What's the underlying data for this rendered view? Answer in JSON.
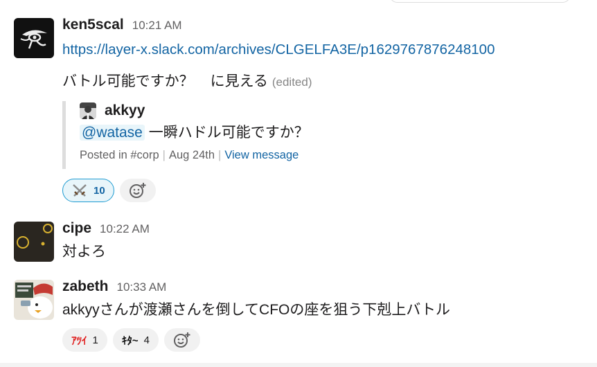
{
  "messages": [
    {
      "author": "ken5scal",
      "time": "10:21 AM",
      "link": "https://layer-x.slack.com/archives/CLGELFA3E/p1629767876248100",
      "text_part1": "バトル可能ですか？",
      "text_part2": "に見える",
      "edited": "(edited)",
      "quote": {
        "author": "akkyy",
        "mention": "@watase",
        "text": " 一瞬ハドル可能ですか？",
        "posted_in": "Posted in #corp",
        "date": "Aug 24th",
        "view": "View message"
      },
      "reactions": [
        {
          "icon": "crossed-swords-icon",
          "count": "10"
        }
      ]
    },
    {
      "author": "cipe",
      "time": "10:22 AM",
      "text": "対よろ"
    },
    {
      "author": "zabeth",
      "time": "10:33 AM",
      "text": "akkyyさんが渡瀬さんを倒してCFOの座を狙う下剋上バトル",
      "reactions": [
        {
          "icon": "atsui-icon",
          "label": "ｱﾂｲ",
          "count": "1"
        },
        {
          "icon": "kita-icon",
          "label": "ｷﾀ~",
          "count": "4"
        }
      ]
    }
  ],
  "colors": {
    "link": "#1264a3",
    "mention_bg": "#e8f5fa",
    "reaction_active_border": "#1d9bd1",
    "atsui_red": "#e01e1e"
  }
}
